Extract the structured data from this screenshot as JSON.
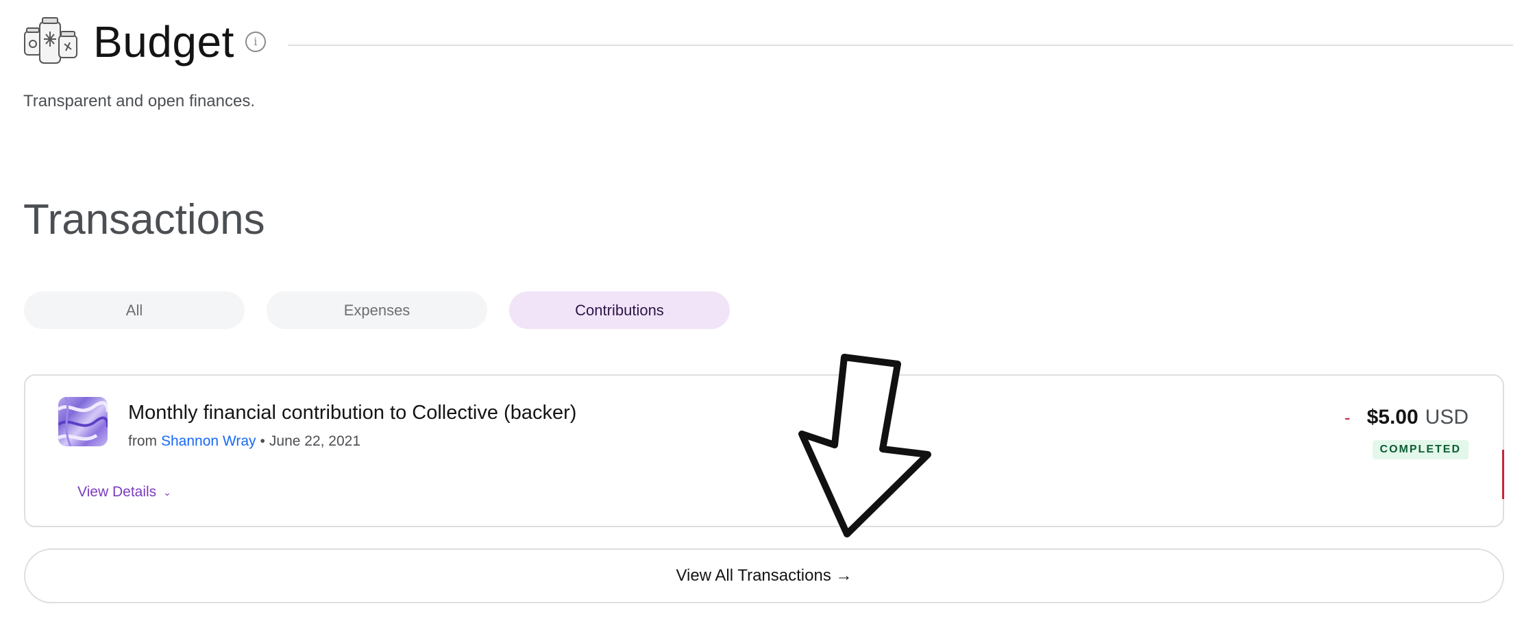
{
  "budget": {
    "title": "Budget",
    "info_icon": "info-icon",
    "description": "Transparent and open finances."
  },
  "transactions": {
    "title": "Transactions",
    "tabs": [
      {
        "label": "All",
        "active": false
      },
      {
        "label": "Expenses",
        "active": false
      },
      {
        "label": "Contributions",
        "active": true
      }
    ],
    "items": [
      {
        "title": "Monthly financial contribution to Collective (backer)",
        "from_prefix": "from",
        "from_name": "Shannon Wray",
        "separator": "•",
        "date": "June 22, 2021",
        "sign": "-",
        "amount": "$5.00",
        "currency": "USD",
        "status": "COMPLETED",
        "details_label": "View Details"
      }
    ],
    "view_all_label": "View All Transactions →"
  },
  "colors": {
    "accent_purple": "#7a3bbf",
    "link_blue": "#1869f5",
    "active_tab_bg": "#f1e4f8",
    "status_bg": "#e3f7ea",
    "status_text": "#0a5c33",
    "negative": "#c5253a"
  },
  "icons": {
    "budget": "jars-icon",
    "details_chevron": "chevron-down-icon",
    "annotation": "down-arrow-icon"
  }
}
